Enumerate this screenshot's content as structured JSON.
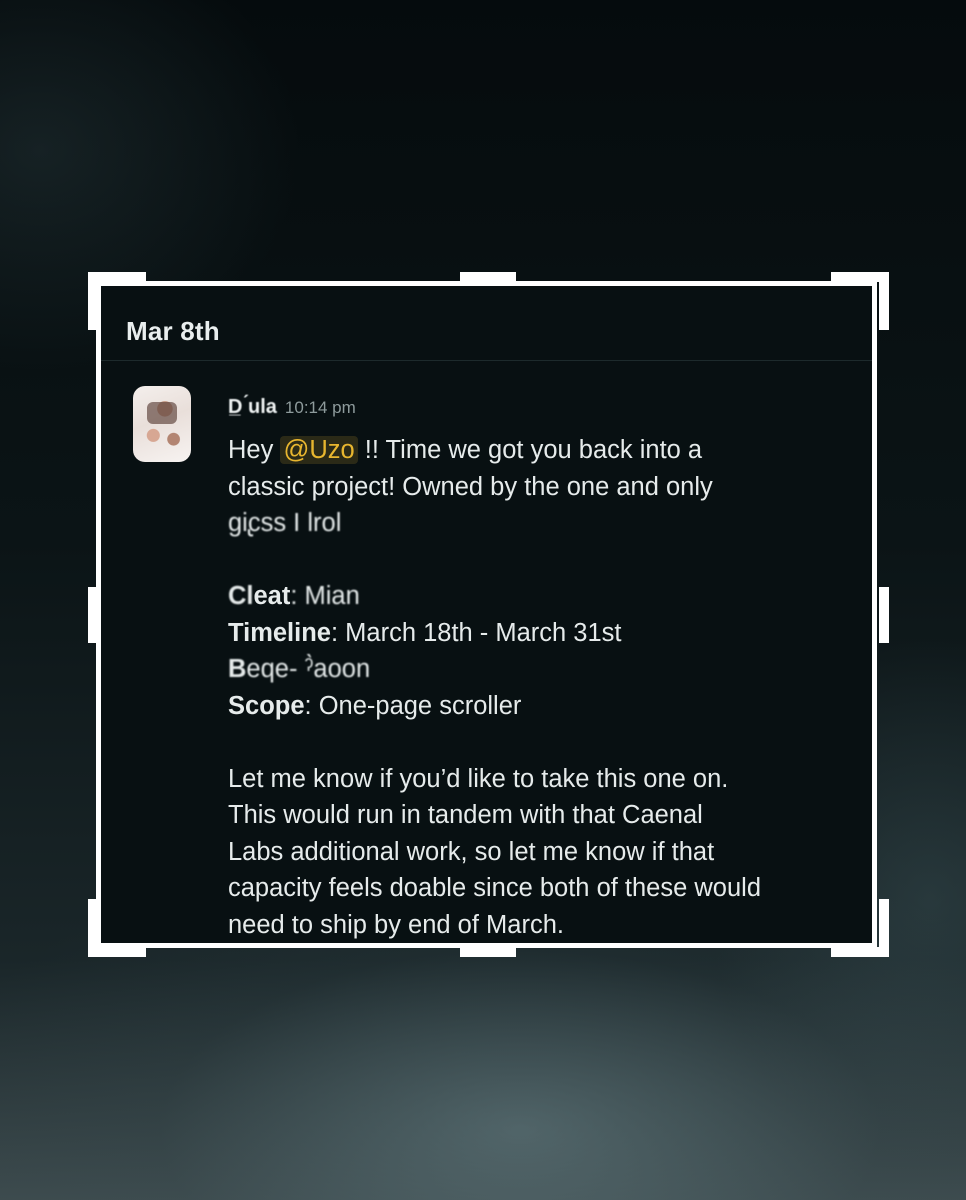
{
  "chat": {
    "date_header": "Mar 8th",
    "message": {
      "author": "D̲ ́ula",
      "time": "10:14 pm",
      "greeting_pre": "Hey ",
      "mention": "@Uzo",
      "greeting_post": " !! Time we got you back into a",
      "line2": "classic project! Owned by the one and only",
      "line3": "gi̢css I lrol",
      "client_label": "Cl",
      "client_label_rest": "eat",
      "client_value": ": Mian",
      "timeline_label": "Timeline",
      "timeline_value": ": March 18th - March 31st",
      "budget_label": "B",
      "budget_value": "eqe-        ˀ̀aoon",
      "scope_label": "Scope",
      "scope_value": ": One-page scroller",
      "para2_line1": "Let me know if you’d like to take this one on.",
      "para2_line2": "This would run in tandem with that Caenal",
      "para2_line3": "Labs additional work, so let me know if that",
      "para2_line4": "capacity feels doable since both of these would",
      "para2_line5": "need to ship by end of March."
    }
  },
  "colors": {
    "mention": "#e8b62f",
    "frame": "#ffffff",
    "panel_bg": "#081012"
  }
}
